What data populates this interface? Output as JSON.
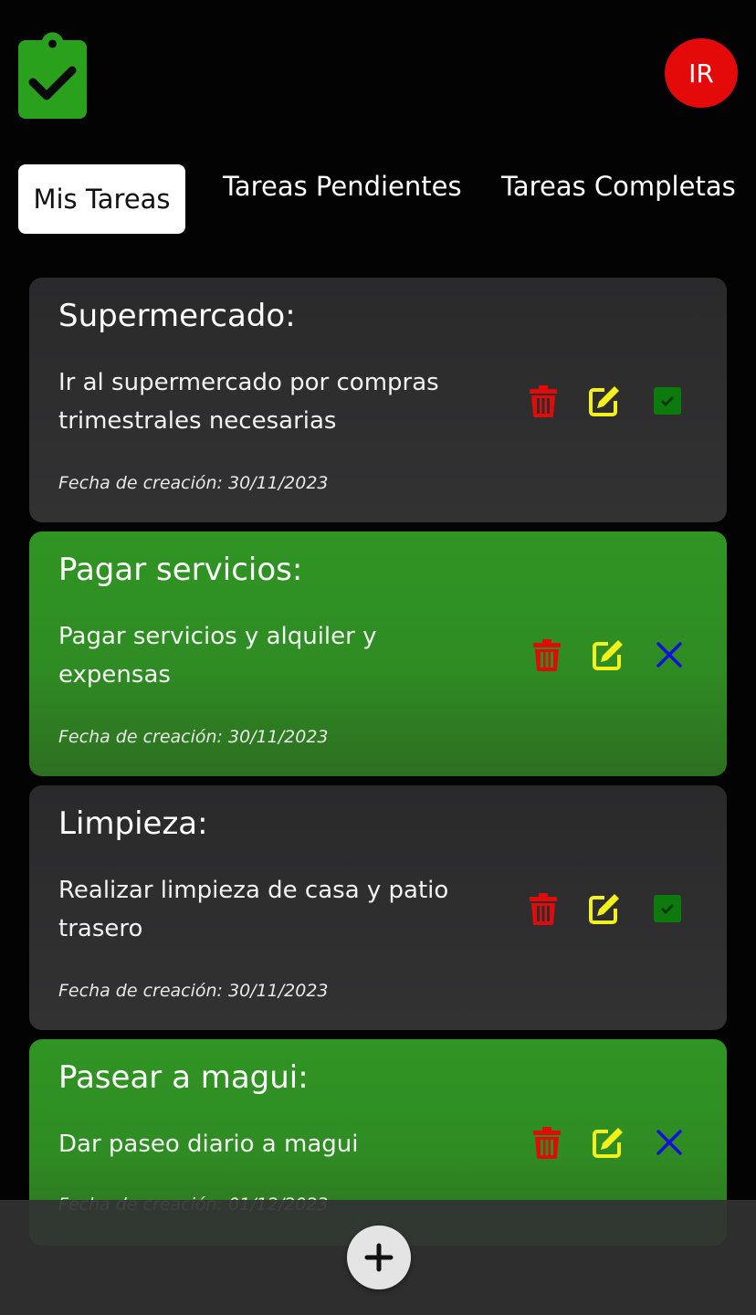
{
  "header": {
    "logo_icon": "clipboard-check-icon",
    "avatar_initials": "IR"
  },
  "tabs": [
    {
      "label": "Mis Tareas",
      "active": true
    },
    {
      "label": "Tareas Pendientes",
      "active": false
    },
    {
      "label": "Tareas Completas",
      "active": false
    }
  ],
  "tasks": [
    {
      "title": "Supermercado:",
      "description": "Ir al supermercado por compras trimestrales necesarias",
      "date": "Fecha de creación: 30/11/2023",
      "completed": false,
      "status_icon": "checkbox-checked-icon"
    },
    {
      "title": "Pagar servicios:",
      "description": "Pagar servicios y alquiler y expensas",
      "date": "Fecha de creación: 30/11/2023",
      "completed": true,
      "status_icon": "close-icon"
    },
    {
      "title": "Limpieza:",
      "description": "Realizar limpieza de casa y patio trasero",
      "date": "Fecha de creación: 30/11/2023",
      "completed": false,
      "status_icon": "checkbox-checked-icon"
    },
    {
      "title": "Pasear a magui:",
      "description": "Dar paseo diario a magui",
      "date": "Fecha de creación: 01/12/2023",
      "completed": true,
      "status_icon": "close-icon"
    }
  ],
  "colors": {
    "card_dark": "#2d2d2e",
    "card_completed": "#2f8f23",
    "delete": "#e00b0b",
    "edit": "#f2f21a",
    "check": "#0d7a0d",
    "uncheck": "#1010d8",
    "avatar": "#e40a0a"
  },
  "fab": {
    "icon": "plus-icon"
  }
}
